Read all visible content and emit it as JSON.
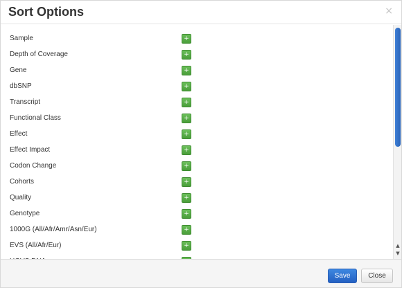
{
  "modal": {
    "title": "Sort Options",
    "close_glyph": "×"
  },
  "sort_fields": [
    {
      "label": "Sample",
      "add_icon": "plus-icon",
      "add_glyph": "+"
    },
    {
      "label": "Depth of Coverage",
      "add_icon": "plus-icon",
      "add_glyph": "+"
    },
    {
      "label": "Gene",
      "add_icon": "plus-icon",
      "add_glyph": "+"
    },
    {
      "label": "dbSNP",
      "add_icon": "plus-icon",
      "add_glyph": "+"
    },
    {
      "label": "Transcript",
      "add_icon": "plus-icon",
      "add_glyph": "+"
    },
    {
      "label": "Functional Class",
      "add_icon": "plus-icon",
      "add_glyph": "+"
    },
    {
      "label": "Effect",
      "add_icon": "plus-icon",
      "add_glyph": "+"
    },
    {
      "label": "Effect Impact",
      "add_icon": "plus-icon",
      "add_glyph": "+"
    },
    {
      "label": "Codon Change",
      "add_icon": "plus-icon",
      "add_glyph": "+"
    },
    {
      "label": "Cohorts",
      "add_icon": "plus-icon",
      "add_glyph": "+"
    },
    {
      "label": "Quality",
      "add_icon": "plus-icon",
      "add_glyph": "+"
    },
    {
      "label": "Genotype",
      "add_icon": "plus-icon",
      "add_glyph": "+"
    },
    {
      "label": "1000G (All/Afr/Amr/Asn/Eur)",
      "add_icon": "plus-icon",
      "add_glyph": "+"
    },
    {
      "label": "EVS (All/Afr/Eur)",
      "add_icon": "plus-icon",
      "add_glyph": "+"
    },
    {
      "label": "HGVS DNA",
      "add_icon": "plus-icon",
      "add_glyph": "+"
    }
  ],
  "scrollbar": {
    "up_glyph": "▲",
    "down_glyph": "▼"
  },
  "footer": {
    "save_label": "Save",
    "close_label": "Close"
  },
  "colors": {
    "add_button": "#4a9e3a",
    "save_button": "#2460c2",
    "scroll_thumb": "#2a64b8"
  }
}
